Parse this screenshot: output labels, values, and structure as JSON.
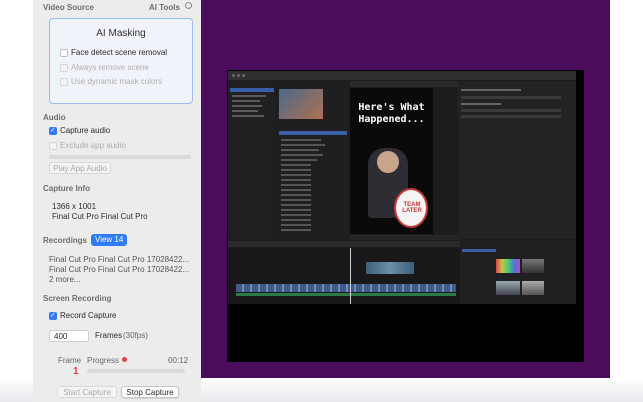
{
  "sidebar": {
    "video_source_label": "Video Source",
    "ai_tools_label": "AI Tools",
    "ai_masking": {
      "title": "AI Masking",
      "options": [
        {
          "label": "Face detect scene removal",
          "checked": false,
          "enabled": true
        },
        {
          "label": "Always remove scene",
          "checked": false,
          "enabled": false
        },
        {
          "label": "Use dynamic mask colors",
          "checked": false,
          "enabled": false
        }
      ]
    },
    "audio": {
      "title": "Audio",
      "capture_audio": {
        "label": "Capture audio",
        "checked": true
      },
      "exclude_app_audio": {
        "label": "Exclude app audio",
        "checked": false,
        "enabled": false
      },
      "play_app_audio_button": "Play App Audio"
    },
    "capture_info": {
      "title": "Capture Info",
      "resolution": "1366 x 1001",
      "app_name": "Final Cut Pro Final Cut Pro"
    },
    "recordings": {
      "title": "Recordings",
      "view_button": "View 14",
      "items": [
        "Final Cut Pro Final Cut Pro 17028422...",
        "Final Cut Pro Final Cut Pro 17028422..."
      ],
      "more": "2 more..."
    },
    "screen_recording": {
      "title": "Screen Recording",
      "record_capture": {
        "label": "Record Capture",
        "checked": true
      },
      "frames_value": "400",
      "frames_label": "Frames",
      "fps_label": "(30fps)",
      "frame_col_label": "Frame",
      "frame_value": "1",
      "progress_label": "Progress",
      "progress_time": "00:12",
      "start_button": "Start Capture",
      "stop_button": "Stop Capture"
    }
  },
  "preview": {
    "video_headline_1": "Here's What",
    "video_headline_2": "Happened...",
    "sign_text_1": "TEAM",
    "sign_text_2": "LATER"
  },
  "colors": {
    "accent": "#2f7cf6",
    "background_purple": "#4b0c5c",
    "record_red": "#e04343"
  }
}
